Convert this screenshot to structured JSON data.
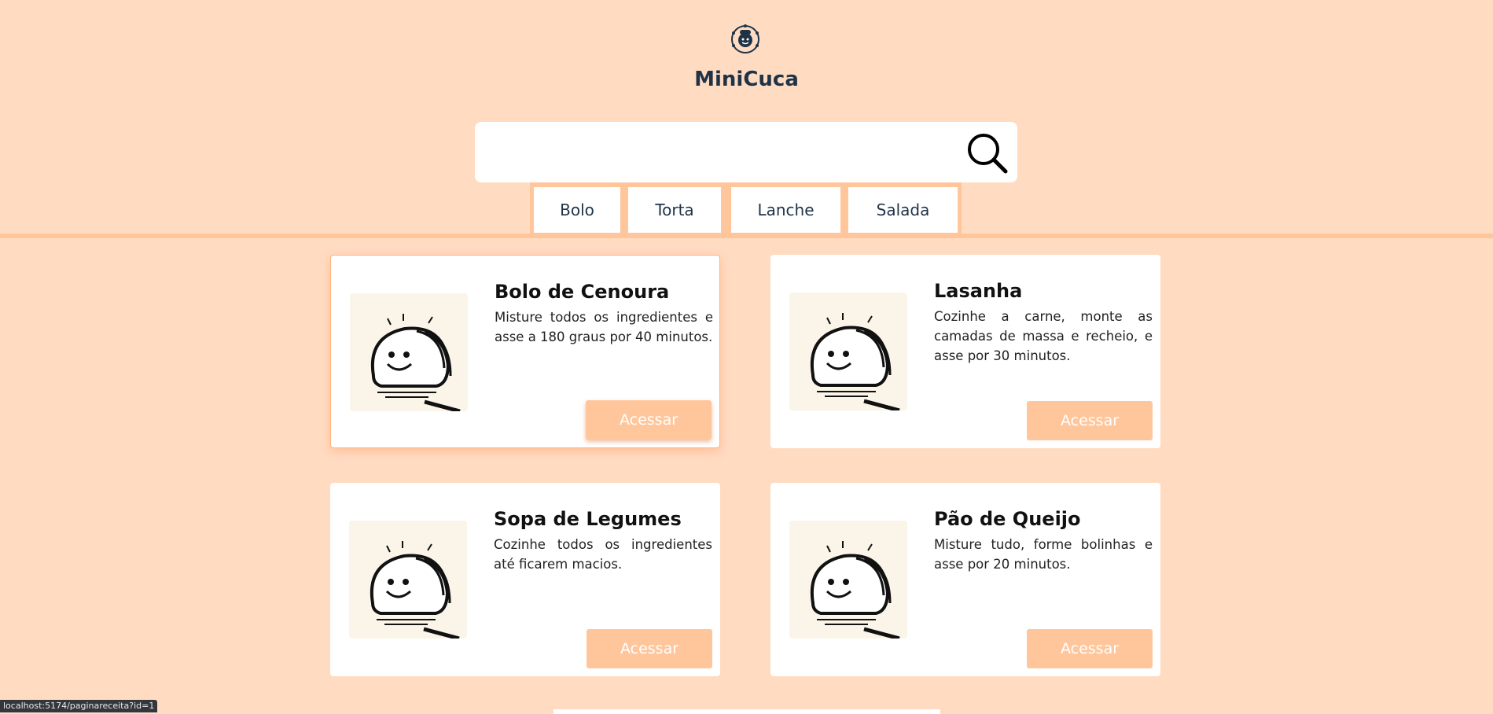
{
  "header": {
    "brand": "MiniCuca",
    "logo_icon": "chef-logo-icon"
  },
  "search": {
    "value": "",
    "placeholder": "",
    "icon": "search-icon"
  },
  "categories": [
    "Bolo",
    "Torta",
    "Lanche",
    "Salada"
  ],
  "recipes": [
    {
      "title": "Bolo de Cenoura",
      "description": "Misture todos os ingredientes e asse a 180 graus por 40 minutos.",
      "button": "Acessar",
      "image_icon": "bread-loaf-illustration-icon"
    },
    {
      "title": "Lasanha",
      "description": "Cozinhe a carne, monte as camadas de massa e recheio, e asse por 30 minutos.",
      "button": "Acessar",
      "image_icon": "bread-loaf-illustration-icon"
    },
    {
      "title": "Sopa de Legumes",
      "description": "Cozinhe todos os ingredientes até ficarem macios.",
      "button": "Acessar",
      "image_icon": "bread-loaf-illustration-icon"
    },
    {
      "title": "Pão de Queijo",
      "description": "Misture tudo, forme bolinhas e asse por 20 minutos.",
      "button": "Acessar",
      "image_icon": "bread-loaf-illustration-icon"
    }
  ],
  "status_bar": {
    "url": "localhost:5174/paginareceita?id=1"
  },
  "colors": {
    "background": "#ffdbc2",
    "accent": "#ffc69c",
    "brand_text": "#1f3347"
  }
}
